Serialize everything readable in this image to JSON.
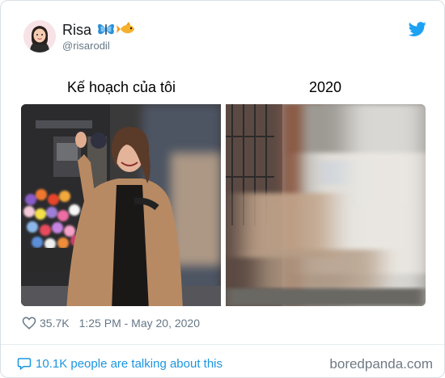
{
  "author": {
    "name": "Risa",
    "handle": "@risarodil",
    "avatar_icon": "cartoon-woman-avatar",
    "emoji_icons": [
      "butterfly-icon",
      "fish-icon"
    ]
  },
  "platform_icon": "twitter-bird-icon",
  "captions": {
    "left": "Kế hoạch của tôi",
    "right": "2020"
  },
  "photos": {
    "left": "woman-in-camel-coat-thumbs-up",
    "right": "motion-blurred-street"
  },
  "meta": {
    "likes": "35.7K",
    "timestamp": "1:25 PM - May 20, 2020"
  },
  "footer": {
    "talking": "10.1K people are talking about this",
    "watermark": "boredpanda.com"
  },
  "colors": {
    "twitter_blue": "#1da1f2",
    "link_blue": "#1b95e0",
    "gray_text": "#657786"
  }
}
